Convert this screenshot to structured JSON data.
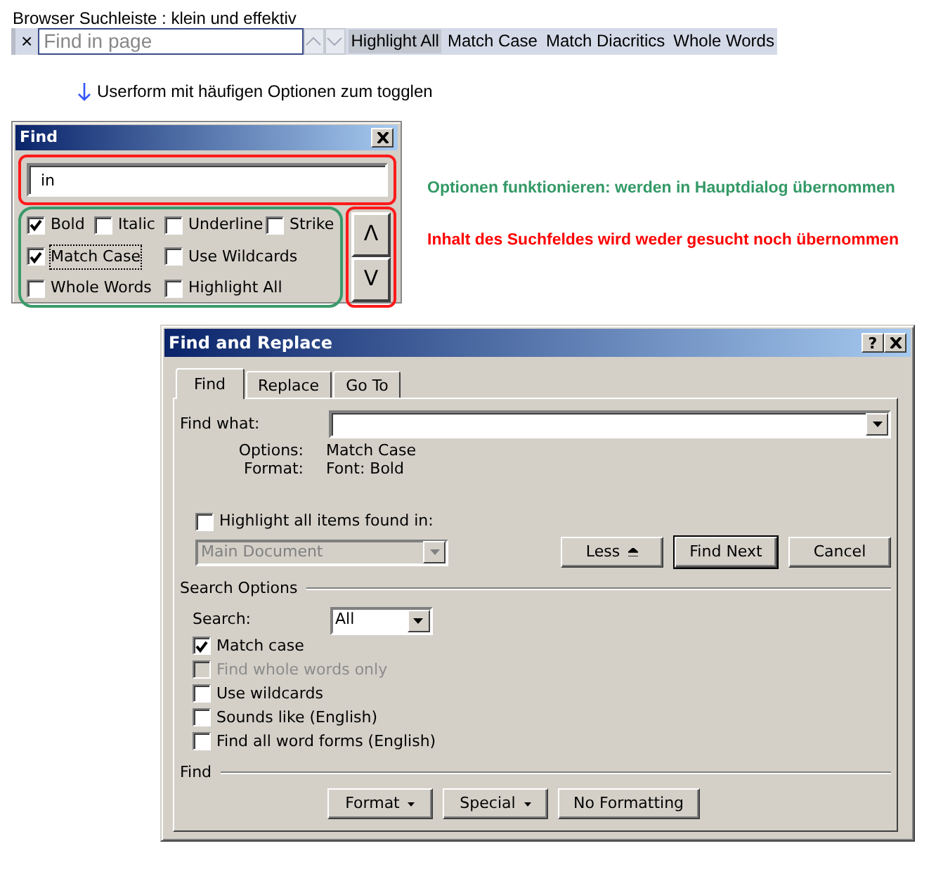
{
  "caption": "Browser Suchleiste : klein und effektiv",
  "browser_findbar": {
    "close": "×",
    "placeholder": "Find in page",
    "options": [
      {
        "label": "Highlight All",
        "selected": true
      },
      {
        "label": "Match Case",
        "selected": false
      },
      {
        "label": "Match Diacritics",
        "selected": false
      },
      {
        "label": "Whole Words",
        "selected": false
      }
    ]
  },
  "note": "Userform mit häufigen Optionen zum togglen",
  "userform": {
    "title": "Find",
    "query": "in",
    "rows": [
      [
        {
          "label": "Bold",
          "checked": true,
          "focused": false
        },
        {
          "label": "Italic",
          "checked": false,
          "focused": false
        },
        {
          "label": "Underline",
          "checked": false,
          "focused": false
        },
        {
          "label": "Strike",
          "checked": false,
          "focused": false
        }
      ],
      [
        {
          "label": "Match Case",
          "checked": true,
          "focused": true
        },
        {
          "label": "Use Wildcards",
          "checked": false,
          "focused": false
        }
      ],
      [
        {
          "label": "Whole Words",
          "checked": false,
          "focused": false
        },
        {
          "label": "Highlight All",
          "checked": false,
          "focused": false
        }
      ]
    ],
    "prev": "Λ",
    "next": "V"
  },
  "annotations": [
    {
      "text": "Optionen funktionieren: werden in Hauptdialog übernommen",
      "color": "#339966"
    },
    {
      "text": "Inhalt des Suchfeldes wird weder gesucht noch übernommen",
      "color": "#ff0000"
    }
  ],
  "dialog": {
    "title": "Find and Replace",
    "help": "?",
    "tabs": [
      {
        "label": "Find",
        "selected": true
      },
      {
        "label": "Replace",
        "selected": false
      },
      {
        "label": "Go To",
        "selected": false
      }
    ],
    "find_what_label": "Find what:",
    "info": [
      {
        "label": "Options:",
        "value": "Match Case"
      },
      {
        "label": "Format:",
        "value": "Font: Bold"
      }
    ],
    "highlight": {
      "label": "Highlight all items found in:",
      "checked": false
    },
    "scope": {
      "value": "Main Document",
      "disabled": true
    },
    "buttons": [
      {
        "label": "Less",
        "kind": "less",
        "default": false
      },
      {
        "label": "Find Next",
        "kind": "plain",
        "default": true
      },
      {
        "label": "Cancel",
        "kind": "plain",
        "default": false
      }
    ],
    "search_options": {
      "heading": "Search Options",
      "search_label": "Search:",
      "search_value": "All",
      "checkboxes": [
        {
          "label": "Match case",
          "checked": true,
          "disabled": false
        },
        {
          "label": "Find whole words only",
          "checked": false,
          "disabled": true
        },
        {
          "label": "Use wildcards",
          "checked": false,
          "disabled": false
        },
        {
          "label": "Sounds like (English)",
          "checked": false,
          "disabled": false
        },
        {
          "label": "Find all word forms (English)",
          "checked": false,
          "disabled": false
        }
      ]
    },
    "find_section": {
      "heading": "Find",
      "buttons": [
        {
          "label": "Format",
          "menu": true
        },
        {
          "label": "Special",
          "menu": true
        },
        {
          "label": "No Formatting",
          "menu": false
        }
      ]
    }
  }
}
